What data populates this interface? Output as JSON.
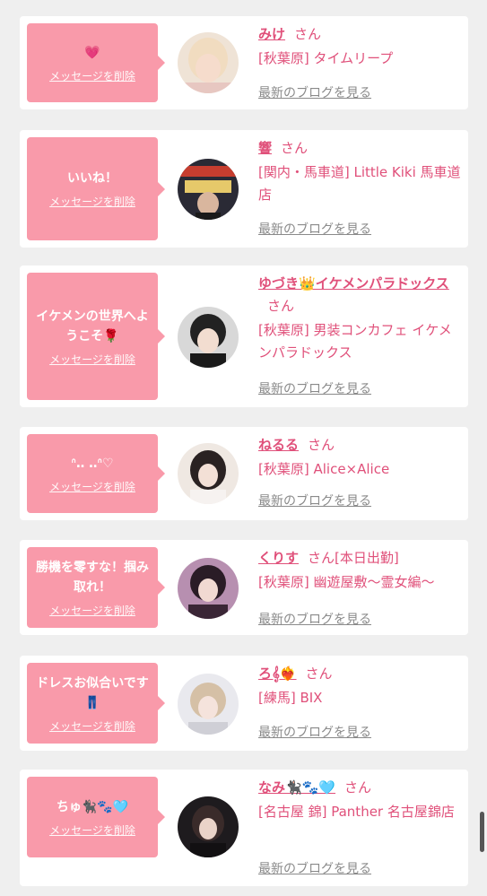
{
  "items": [
    {
      "message": "💗",
      "delete_label": "メッセージを削除",
      "name": "みけ",
      "honorific": "さん",
      "extra": "",
      "shop": "[秋葉原] タイムリープ",
      "blog_link": "最新のブログを見る"
    },
    {
      "message": "いいね！",
      "delete_label": "メッセージを削除",
      "name": "響",
      "honorific": "さん",
      "extra": "",
      "shop": "[関内・馬車道] Little Kiki 馬車道店",
      "blog_link": "最新のブログを見る"
    },
    {
      "message": "イケメンの世界へようこそ🌹",
      "delete_label": "メッセージを削除",
      "name": "ゆづき👑イケメンパラドックス",
      "honorific": "さん",
      "extra": "",
      "shop": "[秋葉原] 男装コンカフェ イケメンパラドックス",
      "blog_link": "最新のブログを見る"
    },
    {
      "message": "ᐢ‥ ‥ᐢ♡",
      "delete_label": "メッセージを削除",
      "name": "ねるる",
      "honorific": "さん",
      "extra": "",
      "shop": "[秋葉原] Alice×Alice",
      "blog_link": "最新のブログを見る"
    },
    {
      "message": "勝機を零すな！掴み取れ！",
      "delete_label": "メッセージを削除",
      "name": "くりす",
      "honorific": "さん",
      "extra": "[本日出勤]",
      "shop": "[秋葉原] 幽遊屋敷〜霊女編〜",
      "blog_link": "最新のブログを見る"
    },
    {
      "message": "ドレスお似合いです👖",
      "delete_label": "メッセージを削除",
      "name": "ろ𝄞❤️‍🔥",
      "honorific": "さん",
      "extra": "",
      "shop": "[練馬] BIX",
      "blog_link": "最新のブログを見る"
    },
    {
      "message": "ちゅ🐈‍⬛🐾🩵",
      "delete_label": "メッセージを削除",
      "name": "なみ🐈‍⬛🐾🩵",
      "honorific": "さん",
      "extra": "",
      "shop": "[名古屋 錦] Panther 名古屋錦店",
      "blog_link": "最新のブログを見る"
    }
  ],
  "colors": {
    "bubble": "#f99aaa",
    "accent": "#e0507a",
    "link_gray": "#8a8a8a",
    "background": "#efefef"
  }
}
